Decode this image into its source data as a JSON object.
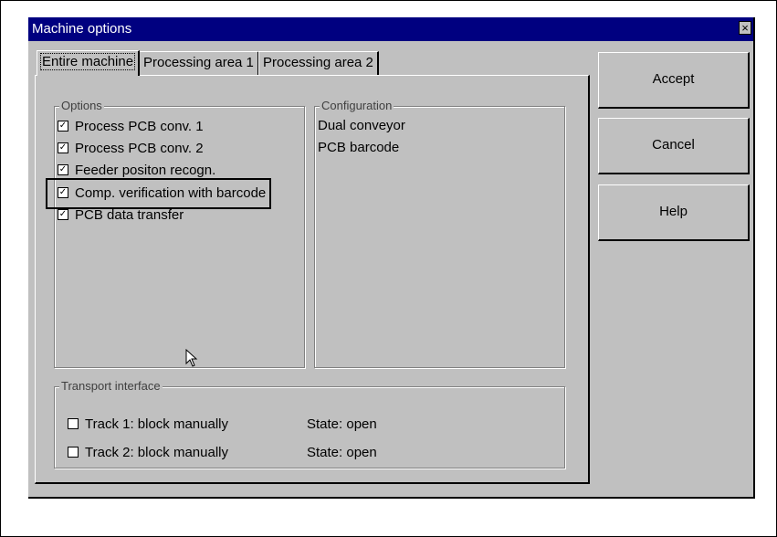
{
  "window": {
    "title": "Machine options",
    "close_icon": "×"
  },
  "tabs": [
    {
      "label": "Entire machine",
      "active": true
    },
    {
      "label": "Processing area 1",
      "active": false
    },
    {
      "label": "Processing area 2",
      "active": false
    }
  ],
  "options_group": {
    "label": "Options",
    "items": [
      {
        "label": "Process PCB conv. 1",
        "checked": true
      },
      {
        "label": "Process PCB conv. 2",
        "checked": true
      },
      {
        "label": "Feeder positon recogn.",
        "checked": true
      },
      {
        "label": "Comp. verification with barcode",
        "checked": true
      },
      {
        "label": "PCB data transfer",
        "checked": true
      }
    ]
  },
  "configuration_group": {
    "label": "Configuration",
    "items": [
      "Dual conveyor",
      "PCB barcode"
    ]
  },
  "transport_group": {
    "label": "Transport interface",
    "tracks": [
      {
        "label": "Track 1: block manually",
        "checked": false,
        "state": "State: open"
      },
      {
        "label": "Track 2: block manually",
        "checked": false,
        "state": "State: open"
      }
    ]
  },
  "buttons": {
    "accept": "Accept",
    "cancel": "Cancel",
    "help": "Help"
  },
  "colors": {
    "titlebar": "#000080",
    "dialog": "#c0c0c0"
  }
}
